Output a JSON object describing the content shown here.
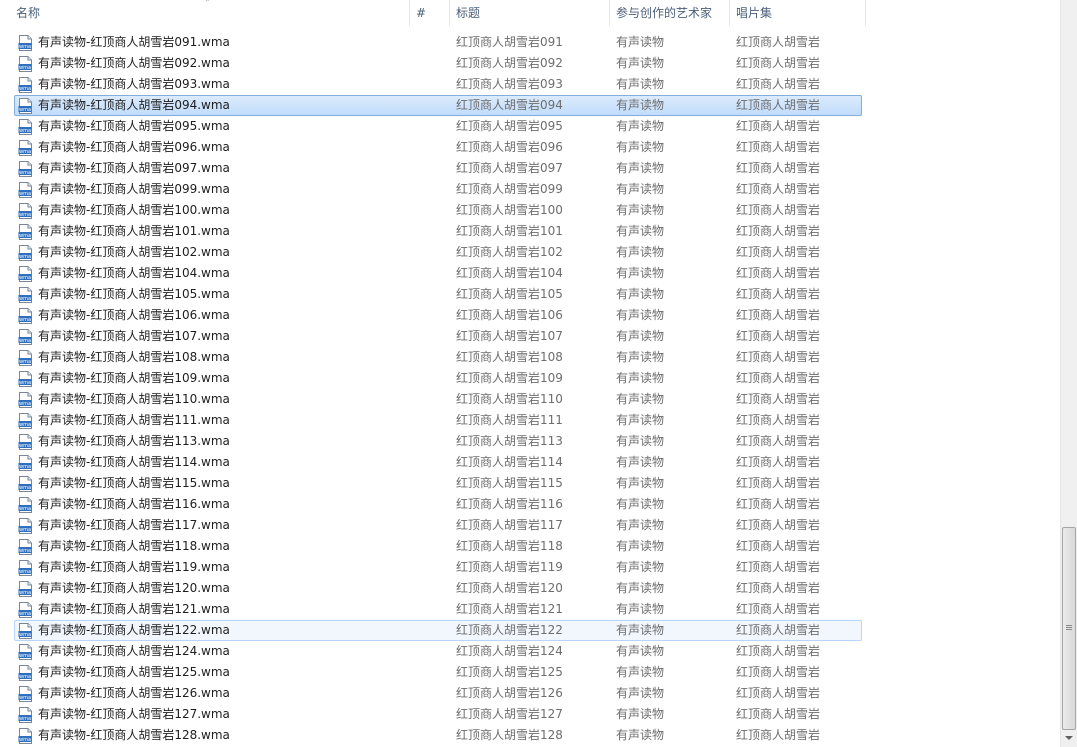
{
  "columns": {
    "name": "名称",
    "number": "#",
    "title": "标题",
    "artist": "参与创作的艺术家",
    "album": "唱片集"
  },
  "sort_indicator": "˄",
  "icons": {
    "file": "wma-audio-file-icon",
    "file_label": "wma"
  },
  "rows": [
    {
      "name": "有声读物-红顶商人胡雪岩091.wma",
      "title": "红顶商人胡雪岩091",
      "artist": "有声读物",
      "album": "红顶商人胡雪岩"
    },
    {
      "name": "有声读物-红顶商人胡雪岩092.wma",
      "title": "红顶商人胡雪岩092",
      "artist": "有声读物",
      "album": "红顶商人胡雪岩"
    },
    {
      "name": "有声读物-红顶商人胡雪岩093.wma",
      "title": "红顶商人胡雪岩093",
      "artist": "有声读物",
      "album": "红顶商人胡雪岩"
    },
    {
      "name": "有声读物-红顶商人胡雪岩094.wma",
      "title": "红顶商人胡雪岩094",
      "artist": "有声读物",
      "album": "红顶商人胡雪岩",
      "state": "selected"
    },
    {
      "name": "有声读物-红顶商人胡雪岩095.wma",
      "title": "红顶商人胡雪岩095",
      "artist": "有声读物",
      "album": "红顶商人胡雪岩"
    },
    {
      "name": "有声读物-红顶商人胡雪岩096.wma",
      "title": "红顶商人胡雪岩096",
      "artist": "有声读物",
      "album": "红顶商人胡雪岩"
    },
    {
      "name": "有声读物-红顶商人胡雪岩097.wma",
      "title": "红顶商人胡雪岩097",
      "artist": "有声读物",
      "album": "红顶商人胡雪岩"
    },
    {
      "name": "有声读物-红顶商人胡雪岩099.wma",
      "title": "红顶商人胡雪岩099",
      "artist": "有声读物",
      "album": "红顶商人胡雪岩"
    },
    {
      "name": "有声读物-红顶商人胡雪岩100.wma",
      "title": "红顶商人胡雪岩100",
      "artist": "有声读物",
      "album": "红顶商人胡雪岩"
    },
    {
      "name": "有声读物-红顶商人胡雪岩101.wma",
      "title": "红顶商人胡雪岩101",
      "artist": "有声读物",
      "album": "红顶商人胡雪岩"
    },
    {
      "name": "有声读物-红顶商人胡雪岩102.wma",
      "title": "红顶商人胡雪岩102",
      "artist": "有声读物",
      "album": "红顶商人胡雪岩"
    },
    {
      "name": "有声读物-红顶商人胡雪岩104.wma",
      "title": "红顶商人胡雪岩104",
      "artist": "有声读物",
      "album": "红顶商人胡雪岩"
    },
    {
      "name": "有声读物-红顶商人胡雪岩105.wma",
      "title": "红顶商人胡雪岩105",
      "artist": "有声读物",
      "album": "红顶商人胡雪岩"
    },
    {
      "name": "有声读物-红顶商人胡雪岩106.wma",
      "title": "红顶商人胡雪岩106",
      "artist": "有声读物",
      "album": "红顶商人胡雪岩"
    },
    {
      "name": "有声读物-红顶商人胡雪岩107.wma",
      "title": "红顶商人胡雪岩107",
      "artist": "有声读物",
      "album": "红顶商人胡雪岩"
    },
    {
      "name": "有声读物-红顶商人胡雪岩108.wma",
      "title": "红顶商人胡雪岩108",
      "artist": "有声读物",
      "album": "红顶商人胡雪岩"
    },
    {
      "name": "有声读物-红顶商人胡雪岩109.wma",
      "title": "红顶商人胡雪岩109",
      "artist": "有声读物",
      "album": "红顶商人胡雪岩"
    },
    {
      "name": "有声读物-红顶商人胡雪岩110.wma",
      "title": "红顶商人胡雪岩110",
      "artist": "有声读物",
      "album": "红顶商人胡雪岩"
    },
    {
      "name": "有声读物-红顶商人胡雪岩111.wma",
      "title": "红顶商人胡雪岩111",
      "artist": "有声读物",
      "album": "红顶商人胡雪岩"
    },
    {
      "name": "有声读物-红顶商人胡雪岩113.wma",
      "title": "红顶商人胡雪岩113",
      "artist": "有声读物",
      "album": "红顶商人胡雪岩"
    },
    {
      "name": "有声读物-红顶商人胡雪岩114.wma",
      "title": "红顶商人胡雪岩114",
      "artist": "有声读物",
      "album": "红顶商人胡雪岩"
    },
    {
      "name": "有声读物-红顶商人胡雪岩115.wma",
      "title": "红顶商人胡雪岩115",
      "artist": "有声读物",
      "album": "红顶商人胡雪岩"
    },
    {
      "name": "有声读物-红顶商人胡雪岩116.wma",
      "title": "红顶商人胡雪岩116",
      "artist": "有声读物",
      "album": "红顶商人胡雪岩"
    },
    {
      "name": "有声读物-红顶商人胡雪岩117.wma",
      "title": "红顶商人胡雪岩117",
      "artist": "有声读物",
      "album": "红顶商人胡雪岩"
    },
    {
      "name": "有声读物-红顶商人胡雪岩118.wma",
      "title": "红顶商人胡雪岩118",
      "artist": "有声读物",
      "album": "红顶商人胡雪岩"
    },
    {
      "name": "有声读物-红顶商人胡雪岩119.wma",
      "title": "红顶商人胡雪岩119",
      "artist": "有声读物",
      "album": "红顶商人胡雪岩"
    },
    {
      "name": "有声读物-红顶商人胡雪岩120.wma",
      "title": "红顶商人胡雪岩120",
      "artist": "有声读物",
      "album": "红顶商人胡雪岩"
    },
    {
      "name": "有声读物-红顶商人胡雪岩121.wma",
      "title": "红顶商人胡雪岩121",
      "artist": "有声读物",
      "album": "红顶商人胡雪岩"
    },
    {
      "name": "有声读物-红顶商人胡雪岩122.wma",
      "title": "红顶商人胡雪岩122",
      "artist": "有声读物",
      "album": "红顶商人胡雪岩",
      "state": "hover"
    },
    {
      "name": "有声读物-红顶商人胡雪岩124.wma",
      "title": "红顶商人胡雪岩124",
      "artist": "有声读物",
      "album": "红顶商人胡雪岩"
    },
    {
      "name": "有声读物-红顶商人胡雪岩125.wma",
      "title": "红顶商人胡雪岩125",
      "artist": "有声读物",
      "album": "红顶商人胡雪岩"
    },
    {
      "name": "有声读物-红顶商人胡雪岩126.wma",
      "title": "红顶商人胡雪岩126",
      "artist": "有声读物",
      "album": "红顶商人胡雪岩"
    },
    {
      "name": "有声读物-红顶商人胡雪岩127.wma",
      "title": "红顶商人胡雪岩127",
      "artist": "有声读物",
      "album": "红顶商人胡雪岩"
    },
    {
      "name": "有声读物-红顶商人胡雪岩128.wma",
      "title": "红顶商人胡雪岩128",
      "artist": "有声读物",
      "album": "红顶商人胡雪岩"
    }
  ],
  "colors": {
    "header_text": "#4c607a",
    "name_text": "#1e1e1e",
    "detail_text": "#6d6d6d",
    "selection_border": "#84acdd",
    "hover_border": "#b8d6fb"
  }
}
